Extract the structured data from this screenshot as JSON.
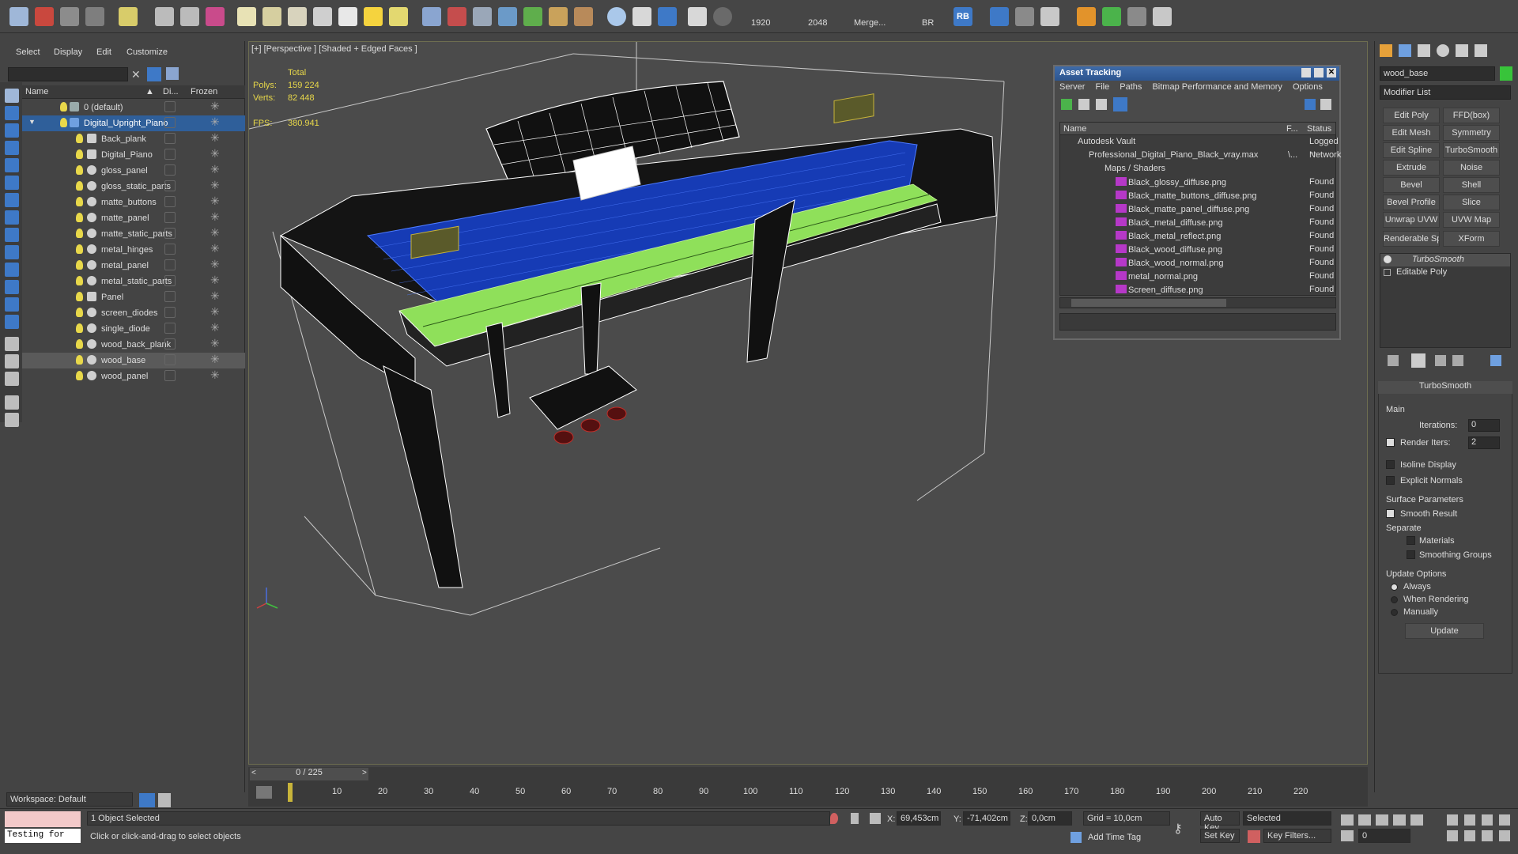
{
  "toolbar": {
    "render_width": "1920",
    "render_height": "2048",
    "merge_label": "Merge...",
    "br_label": "BR",
    "rb_label": "RB"
  },
  "explorer": {
    "menu": [
      "Select",
      "Display",
      "Edit",
      "Customize"
    ],
    "columns": {
      "name": "Name",
      "display": "Di...",
      "frozen": "Frozen"
    },
    "rows": [
      {
        "label": "0 (default)"
      },
      {
        "label": "Digital_Upright_Piano"
      },
      {
        "label": "Back_plank"
      },
      {
        "label": "Digital_Piano"
      },
      {
        "label": "gloss_panel"
      },
      {
        "label": "gloss_static_parts"
      },
      {
        "label": "matte_buttons"
      },
      {
        "label": "matte_panel"
      },
      {
        "label": "matte_static_parts"
      },
      {
        "label": "metal_hinges"
      },
      {
        "label": "metal_panel"
      },
      {
        "label": "metal_static_parts"
      },
      {
        "label": "Panel"
      },
      {
        "label": "screen_diodes"
      },
      {
        "label": "single_diode"
      },
      {
        "label": "wood_back_plank"
      },
      {
        "label": "wood_base"
      },
      {
        "label": "wood_panel"
      }
    ],
    "workspace": "Workspace: Default"
  },
  "viewport": {
    "label": "[+] [Perspective ] [Shaded + Edged Faces ]",
    "stats": {
      "total": "Total",
      "polys_label": "Polys:",
      "polys": "159 224",
      "verts_label": "Verts:",
      "verts": "82 448",
      "fps_label": "FPS:",
      "fps": "380.941"
    }
  },
  "asset_tracking": {
    "title": "Asset Tracking",
    "menu": [
      "Server",
      "File",
      "Paths",
      "Bitmap Performance and Memory",
      "Options"
    ],
    "columns": {
      "name": "Name",
      "f": "F...",
      "status": "Status"
    },
    "rows": [
      {
        "name": "Autodesk Vault",
        "f": "",
        "status": "Logged ..."
      },
      {
        "name": "Professional_Digital_Piano_Black_vray.max",
        "f": "\\...",
        "status": "Network"
      },
      {
        "name": "Maps / Shaders",
        "f": "",
        "status": ""
      },
      {
        "name": "Black_glossy_diffuse.png",
        "f": "",
        "status": "Found"
      },
      {
        "name": "Black_matte_buttons_diffuse.png",
        "f": "",
        "status": "Found"
      },
      {
        "name": "Black_matte_panel_diffuse.png",
        "f": "",
        "status": "Found"
      },
      {
        "name": "Black_metal_diffuse.png",
        "f": "",
        "status": "Found"
      },
      {
        "name": "Black_metal_reflect.png",
        "f": "",
        "status": "Found"
      },
      {
        "name": "Black_wood_diffuse.png",
        "f": "",
        "status": "Found"
      },
      {
        "name": "Black_wood_normal.png",
        "f": "",
        "status": "Found"
      },
      {
        "name": "metal_normal.png",
        "f": "",
        "status": "Found"
      },
      {
        "name": "Screen_diffuse.png",
        "f": "",
        "status": "Found"
      }
    ]
  },
  "command_panel": {
    "object_name": "wood_base",
    "modifier_list": "Modifier List",
    "buttons": [
      "Edit Poly",
      "FFD(box)",
      "Edit Mesh",
      "Symmetry",
      "Edit Spline",
      "TurboSmooth",
      "Extrude",
      "Noise",
      "Bevel",
      "Shell",
      "Bevel Profile",
      "Slice",
      "Unwrap UVW",
      "UVW Map",
      "Renderable Spline",
      "XForm"
    ],
    "stack": [
      "TurboSmooth",
      "Editable Poly"
    ],
    "rollout_title": "TurboSmooth",
    "main_label": "Main",
    "iterations_label": "Iterations:",
    "iterations": "0",
    "render_iters_label": "Render Iters:",
    "render_iters": "2",
    "isoline": "Isoline Display",
    "explicit_normals": "Explicit Normals",
    "surface_params": "Surface Parameters",
    "smooth_result": "Smooth Result",
    "separate": "Separate",
    "materials": "Materials",
    "smoothing_groups": "Smoothing Groups",
    "update_options": "Update Options",
    "always": "Always",
    "when_rendering": "When Rendering",
    "manually": "Manually",
    "update_button": "Update"
  },
  "timeline": {
    "frame": "0 / 225",
    "ticks": [
      "10",
      "20",
      "30",
      "40",
      "50",
      "60",
      "70",
      "80",
      "90",
      "100",
      "110",
      "120",
      "130",
      "140",
      "150",
      "160",
      "170",
      "180",
      "190",
      "200",
      "210",
      "220"
    ]
  },
  "status": {
    "maxscript": "Testing for",
    "selected": "1 Object Selected",
    "prompt": "Click or click-and-drag to select objects",
    "x_label": "X:",
    "x": "69,453cm",
    "y_label": "Y:",
    "y": "-71,402cm",
    "z_label": "Z:",
    "z": "0,0cm",
    "grid": "Grid = 10,0cm",
    "add_time_tag": "Add Time Tag",
    "auto_key": "Auto Key",
    "selected_dropdown": "Selected",
    "set_key": "Set Key",
    "key_filters": "Key Filters...",
    "frame_field": "0"
  },
  "colors": {
    "accent_blue": "#2f5f9a",
    "wire_green": "#8fe05a",
    "wire_blue": "#2f5bd8",
    "stat_yellow": "#e8d84a"
  }
}
